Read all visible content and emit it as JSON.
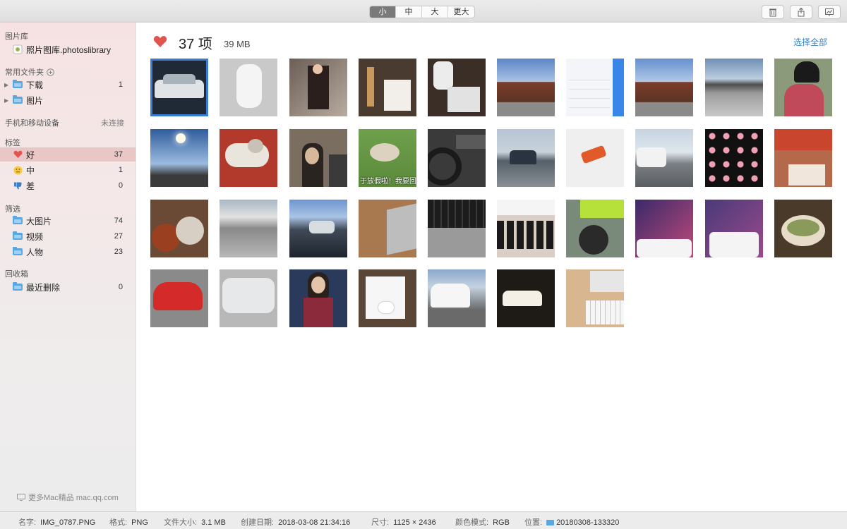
{
  "toolbar": {
    "size_options": [
      "小",
      "中",
      "大",
      "更大"
    ],
    "active_size": "小"
  },
  "sidebar": {
    "library_header": "图片库",
    "library_item": "照片图库.photoslibrary",
    "folders_header": "常用文件夹",
    "folders": [
      {
        "label": "下载",
        "count": "1"
      },
      {
        "label": "图片",
        "count": ""
      }
    ],
    "devices_header": "手机和移动设备",
    "devices_status": "未连接",
    "tags_header": "标签",
    "tags": [
      {
        "label": "好",
        "count": "37",
        "icon": "heart-icon"
      },
      {
        "label": "中",
        "count": "1",
        "icon": "neutral-face-icon"
      },
      {
        "label": "差",
        "count": "0",
        "icon": "thumbs-down-icon"
      }
    ],
    "filter_header": "筛选",
    "filters": [
      {
        "label": "大图片",
        "count": "74"
      },
      {
        "label": "视频",
        "count": "27"
      },
      {
        "label": "人物",
        "count": "23"
      }
    ],
    "trash_header": "回收箱",
    "trash": [
      {
        "label": "最近删除",
        "count": "0"
      }
    ],
    "footer_link": "更多Mac精品 mac.qq.com"
  },
  "main": {
    "title": "37 项",
    "size": "39 MB",
    "select_all": "选择全部",
    "caption_text": "于放假啦！我要回"
  },
  "status": {
    "name_label": "名字:",
    "name_value": "IMG_0787.PNG",
    "format_label": "格式:",
    "format_value": "PNG",
    "filesize_label": "文件大小:",
    "filesize_value": "3.1 MB",
    "created_label": "创建日期:",
    "created_value": "2018-03-08 21:34:16",
    "dims_label": "尺寸:",
    "dims_value": "1125 × 2436",
    "color_label": "颜色模式:",
    "color_value": "RGB",
    "location_label": "位置:",
    "location_value": "20180308-133320"
  },
  "colors": {
    "accent": "#3b82c4",
    "selection": "#3a7bd5",
    "heart": "#e0564f"
  }
}
